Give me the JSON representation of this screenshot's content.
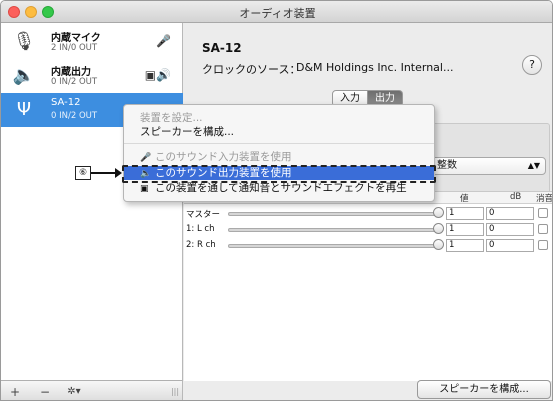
{
  "window": {
    "title": "オーディオ装置"
  },
  "sidebar": {
    "devices": [
      {
        "name": "内蔵マイク",
        "io": "2 IN/0 OUT",
        "icon": "microphone-icon",
        "right_icon": "microphone-indicator-icon",
        "selected": false
      },
      {
        "name": "内蔵出力",
        "io": "0 IN/2 OUT",
        "icon": "speaker-icon",
        "right_icon": "sound-output-indicator-icon",
        "selected": false
      },
      {
        "name": "SA-12",
        "io": "0 IN/2 OUT",
        "icon": "usb-icon",
        "right_icon": "",
        "selected": true
      }
    ],
    "footer": {
      "add_label": "+",
      "remove_label": "−",
      "gear_label": "✲▾",
      "resize_label": "|||"
    }
  },
  "detail": {
    "device_title": "SA-12",
    "clock_label": "クロックのソース：",
    "clock_value": "D&M Holdings Inc. Internal...",
    "help_label": "?",
    "tabs": [
      {
        "label": "入力",
        "active": false
      },
      {
        "label": "出力",
        "active": true
      }
    ],
    "format_value": "整数",
    "volume_table": {
      "headers": [
        "値",
        "dB",
        "消音"
      ],
      "rows": [
        {
          "name": "マスター",
          "value": "1",
          "db": "0",
          "muted": false
        },
        {
          "name": "1: L ch",
          "value": "1",
          "db": "0",
          "muted": false
        },
        {
          "name": "2: R ch",
          "value": "1",
          "db": "0",
          "muted": false
        }
      ]
    },
    "configure_button": "スピーカーを構成..."
  },
  "context_menu": {
    "items": [
      {
        "label": "装置を設定...",
        "enabled": false,
        "icon": ""
      },
      {
        "label": "スピーカーを構成...",
        "enabled": true,
        "icon": ""
      },
      {
        "label": "このサウンド入力装置を使用",
        "enabled": false,
        "icon": "microphone-icon"
      },
      {
        "label": "このサウンド出力装置を使用",
        "enabled": true,
        "icon": "speaker-icon",
        "highlighted": true
      },
      {
        "label": "この装置を通して通知音とサウンドエフェクトを再生",
        "enabled": true,
        "icon": "alert-sound-icon"
      }
    ]
  },
  "annotation": {
    "callout_number": "⑥"
  },
  "colors": {
    "selection_blue": "#3d8ee0",
    "menu_highlight": "#3a6dd8"
  }
}
